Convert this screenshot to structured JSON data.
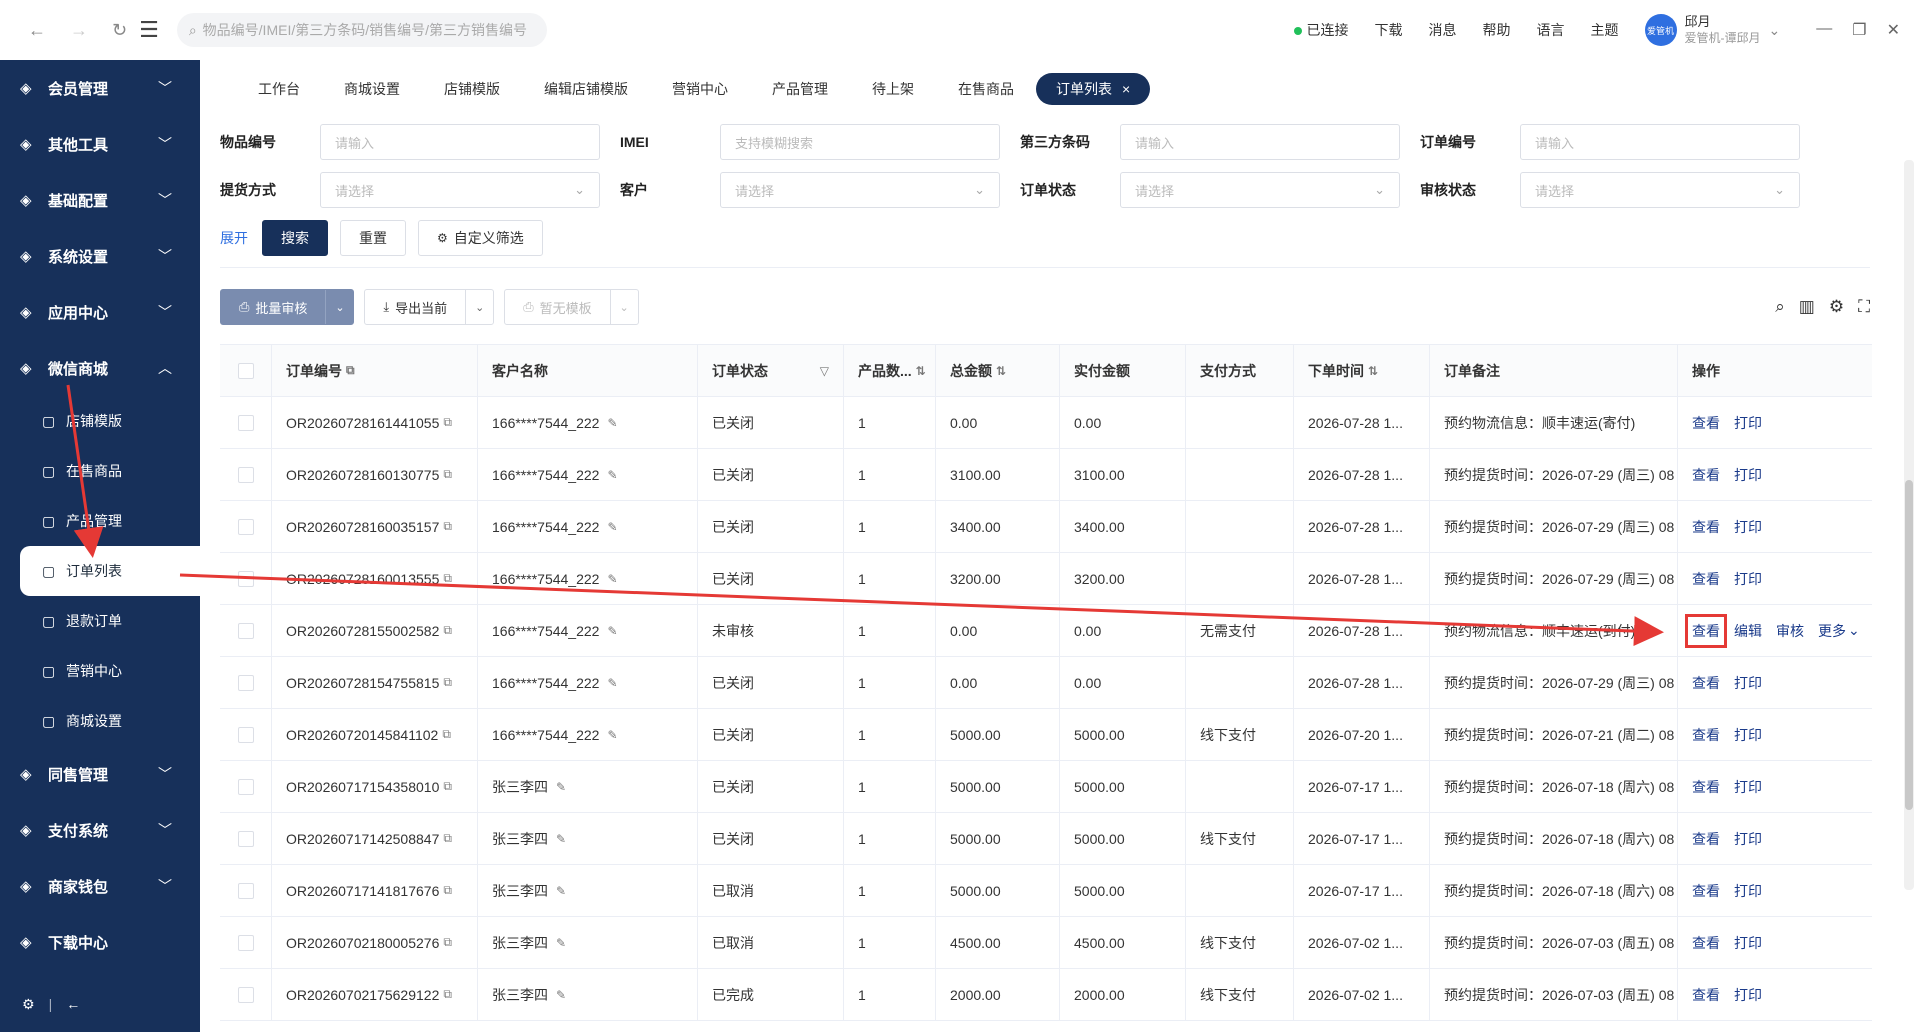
{
  "search": {
    "placeholder": "物品编号/IMEI/第三方条码/销售编号/第三方销售编号"
  },
  "header": {
    "status": "已连接",
    "items": [
      "下载",
      "消息",
      "帮助",
      "语言",
      "主题"
    ],
    "user_name": "邱月",
    "user_sub": "爱管机-谭邱月",
    "avatar_text": "爱管机"
  },
  "sidebar": {
    "top": [
      {
        "label": "会员管理",
        "icon": "user-icon"
      },
      {
        "label": "其他工具",
        "icon": "gear-icon"
      },
      {
        "label": "基础配置",
        "icon": "config-icon"
      },
      {
        "label": "系统设置",
        "icon": "shield-icon"
      },
      {
        "label": "应用中心",
        "icon": "grid-icon"
      },
      {
        "label": "微信商城",
        "icon": "shop-icon"
      }
    ],
    "sub": [
      {
        "label": "店铺模版",
        "icon": "template-icon"
      },
      {
        "label": "在售商品",
        "icon": "upload-icon"
      },
      {
        "label": "产品管理",
        "icon": "box-icon"
      },
      {
        "label": "订单列表",
        "icon": "tag-icon"
      },
      {
        "label": "退款订单",
        "icon": "refund-icon"
      },
      {
        "label": "营销中心",
        "icon": "marketing-icon"
      },
      {
        "label": "商城设置",
        "icon": "settings-icon"
      }
    ],
    "bottom": [
      {
        "label": "同售管理",
        "icon": "sync-icon"
      },
      {
        "label": "支付系统",
        "icon": "pay-icon"
      },
      {
        "label": "商家钱包",
        "icon": "wallet-icon"
      },
      {
        "label": "下载中心",
        "icon": "download-icon"
      }
    ]
  },
  "tabs": [
    "工作台",
    "商城设置",
    "店铺模版",
    "编辑店铺模版",
    "营销中心",
    "产品管理",
    "待上架",
    "在售商品",
    "订单列表"
  ],
  "filters": {
    "row1": [
      {
        "label": "物品编号",
        "ph": "请输入"
      },
      {
        "label": "IMEI",
        "ph": "支持模糊搜索"
      },
      {
        "label": "第三方条码",
        "ph": "请输入"
      },
      {
        "label": "订单编号",
        "ph": "请输入"
      }
    ],
    "row2": [
      {
        "label": "提货方式",
        "ph": "请选择"
      },
      {
        "label": "客户",
        "ph": "请选择"
      },
      {
        "label": "订单状态",
        "ph": "请选择"
      },
      {
        "label": "审核状态",
        "ph": "请选择"
      }
    ],
    "expand": "展开",
    "search": "搜索",
    "reset": "重置",
    "custom": "自定义筛选"
  },
  "toolbar": {
    "batch": "批量审核",
    "export": "导出当前",
    "template": "暂无模板"
  },
  "columns": [
    "订单编号",
    "客户名称",
    "订单状态",
    "产品数...",
    "总金额",
    "实付金额",
    "支付方式",
    "下单时间",
    "订单备注",
    "操作"
  ],
  "rows": [
    {
      "no": "OR20260728161441055",
      "cust": "166****7544_222",
      "status": "已关闭",
      "qty": "1",
      "total": "0.00",
      "paid": "0.00",
      "pay": "",
      "time": "2026-07-28 1...",
      "note": "预约物流信息：顺丰速运(寄付)",
      "ops": [
        "查看",
        "打印"
      ]
    },
    {
      "no": "OR20260728160130775",
      "cust": "166****7544_222",
      "status": "已关闭",
      "qty": "1",
      "total": "3100.00",
      "paid": "3100.00",
      "pay": "",
      "time": "2026-07-28 1...",
      "note": "预约提货时间：2026-07-29 (周三) 08",
      "ops": [
        "查看",
        "打印"
      ]
    },
    {
      "no": "OR20260728160035157",
      "cust": "166****7544_222",
      "status": "已关闭",
      "qty": "1",
      "total": "3400.00",
      "paid": "3400.00",
      "pay": "",
      "time": "2026-07-28 1...",
      "note": "预约提货时间：2026-07-29 (周三) 08",
      "ops": [
        "查看",
        "打印"
      ]
    },
    {
      "no": "OR20260728160013555",
      "cust": "166****7544_222",
      "status": "已关闭",
      "qty": "1",
      "total": "3200.00",
      "paid": "3200.00",
      "pay": "",
      "time": "2026-07-28 1...",
      "note": "预约提货时间：2026-07-29 (周三) 08",
      "ops": [
        "查看",
        "打印"
      ]
    },
    {
      "no": "OR20260728155002582",
      "cust": "166****7544_222",
      "status": "未审核",
      "qty": "1",
      "total": "0.00",
      "paid": "0.00",
      "pay": "无需支付",
      "time": "2026-07-28 1...",
      "note": "预约物流信息：顺丰速运(到付)",
      "ops": [
        "查看",
        "编辑",
        "审核",
        "更多"
      ]
    },
    {
      "no": "OR20260728154755815",
      "cust": "166****7544_222",
      "status": "已关闭",
      "qty": "1",
      "total": "0.00",
      "paid": "0.00",
      "pay": "",
      "time": "2026-07-28 1...",
      "note": "预约提货时间：2026-07-29 (周三) 08",
      "ops": [
        "查看",
        "打印"
      ]
    },
    {
      "no": "OR20260720145841102",
      "cust": "166****7544_222",
      "status": "已关闭",
      "qty": "1",
      "total": "5000.00",
      "paid": "5000.00",
      "pay": "线下支付",
      "time": "2026-07-20 1...",
      "note": "预约提货时间：2026-07-21 (周二) 08",
      "ops": [
        "查看",
        "打印"
      ]
    },
    {
      "no": "OR20260717154358010",
      "cust": "张三李四",
      "status": "已关闭",
      "qty": "1",
      "total": "5000.00",
      "paid": "5000.00",
      "pay": "",
      "time": "2026-07-17 1...",
      "note": "预约提货时间：2026-07-18 (周六) 08",
      "ops": [
        "查看",
        "打印"
      ]
    },
    {
      "no": "OR20260717142508847",
      "cust": "张三李四",
      "status": "已关闭",
      "qty": "1",
      "total": "5000.00",
      "paid": "5000.00",
      "pay": "线下支付",
      "time": "2026-07-17 1...",
      "note": "预约提货时间：2026-07-18 (周六) 08",
      "ops": [
        "查看",
        "打印"
      ]
    },
    {
      "no": "OR20260717141817676",
      "cust": "张三李四",
      "status": "已取消",
      "qty": "1",
      "total": "5000.00",
      "paid": "5000.00",
      "pay": "",
      "time": "2026-07-17 1...",
      "note": "预约提货时间：2026-07-18 (周六) 08",
      "ops": [
        "查看",
        "打印"
      ]
    },
    {
      "no": "OR20260702180005276",
      "cust": "张三李四",
      "status": "已取消",
      "qty": "1",
      "total": "4500.00",
      "paid": "4500.00",
      "pay": "线下支付",
      "time": "2026-07-02 1...",
      "note": "预约提货时间：2026-07-03 (周五) 08",
      "ops": [
        "查看",
        "打印"
      ]
    },
    {
      "no": "OR20260702175629122",
      "cust": "张三李四",
      "status": "已完成",
      "qty": "1",
      "total": "2000.00",
      "paid": "2000.00",
      "pay": "线下支付",
      "time": "2026-07-02 1...",
      "note": "预约提货时间：2026-07-03 (周五) 08",
      "ops": [
        "查看",
        "打印"
      ]
    }
  ],
  "colors": {
    "brand": "#17305a",
    "link": "#1a3a8a",
    "annotation": "#e53935"
  }
}
